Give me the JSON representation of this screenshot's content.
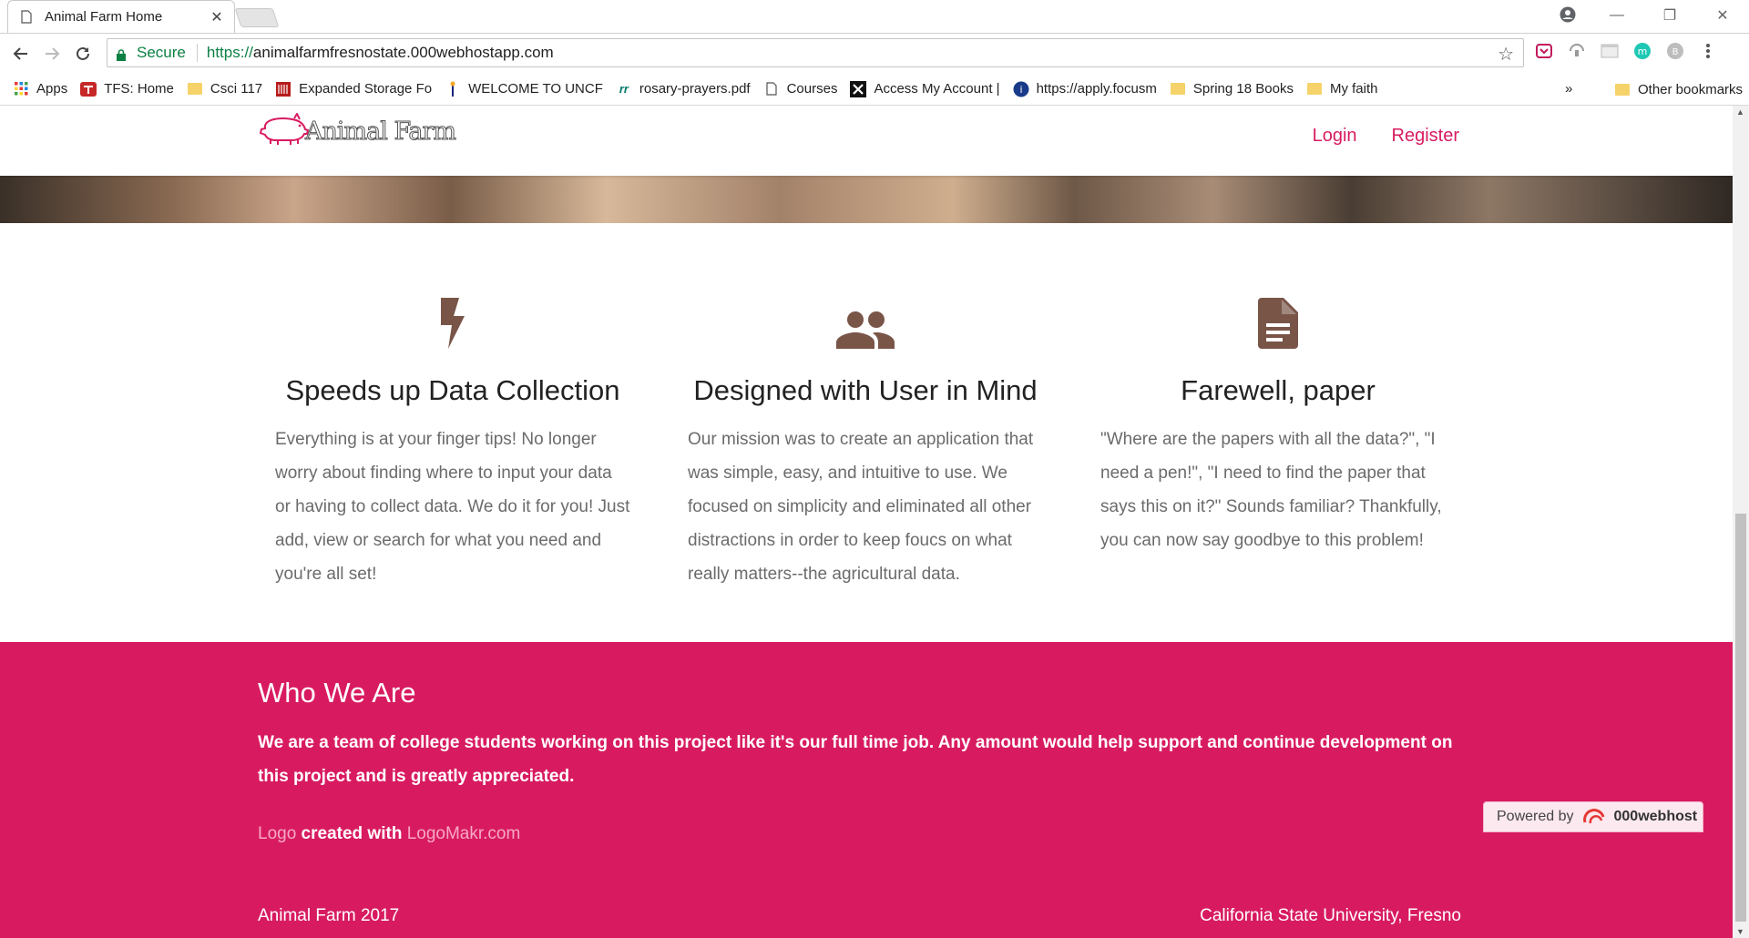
{
  "browser": {
    "tab_title": "Animal Farm Home",
    "tab_close": "✕",
    "window_controls": {
      "minimize": "—",
      "restore": "❐",
      "close": "✕"
    },
    "secure_label": "Secure",
    "url_protocol": "https://",
    "url_host": "animalfarmfresnostate.000webhostapp.com",
    "bookmarks": [
      {
        "label": "Apps",
        "icon": "apps-grid-icon"
      },
      {
        "label": "TFS: Home",
        "icon": "tfs-icon"
      },
      {
        "label": "Csci 117",
        "icon": "folder-icon"
      },
      {
        "label": "Expanded Storage Fo",
        "icon": "storage-icon"
      },
      {
        "label": "WELCOME TO UNCF",
        "icon": "uncf-icon"
      },
      {
        "label": "rosary-prayers.pdf",
        "icon": "rr-icon"
      },
      {
        "label": "Courses",
        "icon": "page-icon"
      },
      {
        "label": "Access My Account |",
        "icon": "x-icon"
      },
      {
        "label": "https://apply.focusm",
        "icon": "globe-icon"
      },
      {
        "label": "Spring 18 Books",
        "icon": "folder-icon"
      },
      {
        "label": "My faith",
        "icon": "folder-icon"
      }
    ],
    "bookmarks_more": "»",
    "other_bookmarks": "Other bookmarks"
  },
  "nav": {
    "logo_text": "Animal Farm",
    "login": "Login",
    "register": "Register"
  },
  "features": [
    {
      "icon": "lightning-bolt-icon",
      "title": "Speeds up Data Collection",
      "text": "Everything is at your finger tips! No longer worry about finding where to input your data or having to collect data. We do it for you! Just add, view or search for what you need and you're all set!"
    },
    {
      "icon": "people-icon",
      "title": "Designed with User in Mind",
      "text": "Our mission was to create an application that was simple, easy, and intuitive to use. We focused on simplicity and eliminated all other distractions in order to keep foucs on what really matters--the agricultural data."
    },
    {
      "icon": "document-icon",
      "title": "Farewell, paper",
      "text": "\"Where are the papers with all the data?\", \"I need a pen!\", \"I need to find the paper that says this on it?\" Sounds familiar? Thankfully, you can now say goodbye to this problem!"
    }
  ],
  "who": {
    "heading": "Who We Are",
    "description": "We are a team of college students working on this project like it's our full time job. Any amount would help support and continue development on this project and is greatly appreciated.",
    "credit_link1": "Logo",
    "credit_middle": " created with ",
    "credit_link2": "LogoMakr.com",
    "footer_left": "Animal Farm 2017",
    "footer_right": "California State University, Fresno"
  },
  "powered": {
    "prefix": "Powered by",
    "brand": "000webhost"
  },
  "colors": {
    "accent": "#d81b60",
    "icon_brown": "#795548",
    "secure_green": "#0b8043"
  }
}
